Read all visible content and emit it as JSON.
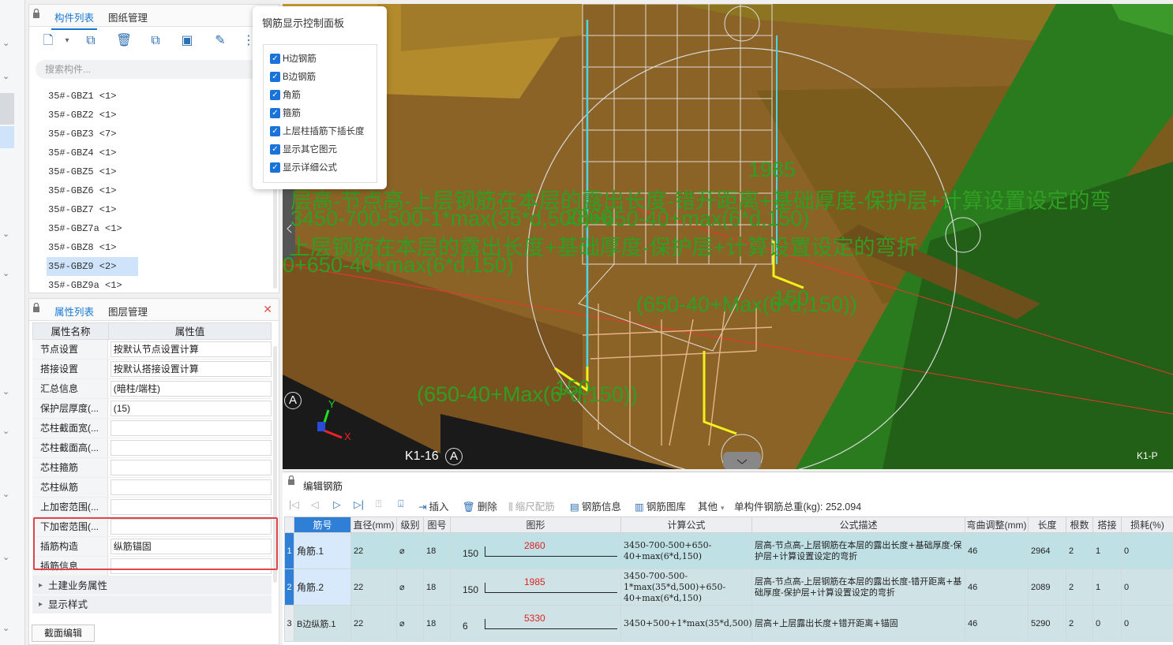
{
  "component_panel": {
    "tab_list": "构件列表",
    "tab_drawings": "图纸管理",
    "search_placeholder": "搜索构件...",
    "items": [
      "35#-GBZ1 <1>",
      "35#-GBZ2 <1>",
      "35#-GBZ3 <7>",
      "35#-GBZ4 <1>",
      "35#-GBZ5 <1>",
      "35#-GBZ6 <1>",
      "35#-GBZ7 <1>",
      "35#-GBZ7a <1>",
      "35#-GBZ8 <1>",
      "35#-GBZ9 <2>",
      "35#-GBZ9a <1>"
    ],
    "selected_index": 9
  },
  "property_panel": {
    "tab_props": "属性列表",
    "tab_layers": "图层管理",
    "col_name": "属性名称",
    "col_value": "属性值",
    "rows": [
      {
        "name": "节点设置",
        "value": "按默认节点设置计算"
      },
      {
        "name": "搭接设置",
        "value": "按默认搭接设置计算"
      },
      {
        "name": "汇总信息",
        "value": "(暗柱/端柱)"
      },
      {
        "name": "保护层厚度(...",
        "value": "(15)"
      },
      {
        "name": "芯柱截面宽(...",
        "value": ""
      },
      {
        "name": "芯柱截面高(...",
        "value": ""
      },
      {
        "name": "芯柱箍筋",
        "value": ""
      },
      {
        "name": "芯柱纵筋",
        "value": ""
      },
      {
        "name": "上加密范围(...",
        "value": ""
      },
      {
        "name": "下加密范围(...",
        "value": ""
      },
      {
        "name": "插筋构造",
        "value": "纵筋锚固"
      },
      {
        "name": "插筋信息",
        "value": ""
      }
    ],
    "groups": [
      "土建业务属性",
      "显示样式"
    ],
    "section_button": "截面编辑"
  },
  "control_panel": {
    "title": "钢筋显示控制面板",
    "options": [
      "H边钢筋",
      "B边钢筋",
      "角筋",
      "箍筋",
      "上层柱插筋下插长度",
      "显示其它图元",
      "显示详细公式"
    ]
  },
  "viewport": {
    "labels": {
      "dim1985": "1985",
      "formula1": "层高-节点高-上层钢筋在本层的露出长度-错开距离+基础厚度-保护层+计算设置设定的弯",
      "formula2": "3450-700-500-1*max(35*d,500)+650-40+max(6*d,150)",
      "dim2860": "2860",
      "formula3": "上层钢筋在本层的露出长度+基础厚度-保护层+计算设置设定的弯折",
      "formula4": "0+650-40+max(6*d,150)",
      "formula5": "(650-40+Max(6*d,150))",
      "dim150a": "150",
      "formula6": "(650-40+Max(6*d,150))",
      "dim150b": "150",
      "axisA1": "A",
      "axisA2": "A",
      "gridlabel": "K1-16",
      "corner": "K1-P",
      "y": "Y",
      "x": "X"
    }
  },
  "edit_panel": {
    "title": "编辑钢筋",
    "toolbar": {
      "insert": "插入",
      "delete": "删除",
      "scale": "缩尺配筋",
      "info": "钢筋信息",
      "library": "钢筋图库",
      "other": "其他",
      "total_label": "单构件钢筋总重(kg): 252.094"
    },
    "headers": [
      "筋号",
      "直径(mm)",
      "级别",
      "图号",
      "图形",
      "计算公式",
      "公式描述",
      "弯曲调整(mm)",
      "长度",
      "根数",
      "搭接",
      "损耗(%)"
    ],
    "rows": [
      {
        "no": "1",
        "name": "角筋.1",
        "dia": "22",
        "grade": "⌀",
        "fig": "18",
        "shape_left": "150",
        "shape_len": "2860",
        "formula": "3450-700-500+650-40+max(6*d,150)",
        "desc": "层高-节点高-上层钢筋在本层的露出长度+基础厚度-保护层+计算设置设定的弯折",
        "bend": "46",
        "length": "2964",
        "count": "2",
        "lap": "1",
        "loss": "0"
      },
      {
        "no": "2",
        "name": "角筋.2",
        "dia": "22",
        "grade": "⌀",
        "fig": "18",
        "shape_left": "150",
        "shape_len": "1985",
        "formula": "3450-700-500-1*max(35*d,500)+650-40+max(6*d,150)",
        "desc": "层高-节点高-上层钢筋在本层的露出长度-错开距离+基础厚度-保护层+计算设置设定的弯折",
        "bend": "46",
        "length": "2089",
        "count": "2",
        "lap": "1",
        "loss": "0"
      },
      {
        "no": "3",
        "name": "B边纵筋.1",
        "dia": "22",
        "grade": "⌀",
        "fig": "18",
        "shape_left": "6",
        "shape_len": "5330",
        "formula": "3450+500+1*max(35*d,500)+28*d",
        "desc": "层高+上层露出长度+错开距离+锚固",
        "bend": "46",
        "length": "5290",
        "count": "2",
        "lap": "0",
        "loss": "0"
      }
    ]
  }
}
